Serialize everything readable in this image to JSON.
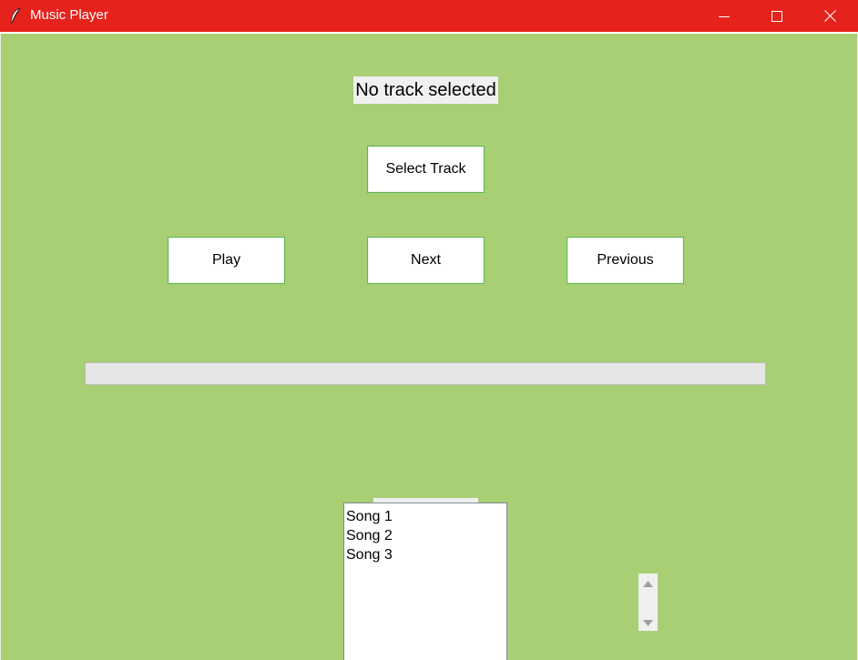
{
  "window": {
    "title": "Music Player"
  },
  "status": {
    "text": "No track selected"
  },
  "buttons": {
    "select_track": "Select Track",
    "play": "Play",
    "next": "Next",
    "previous": "Previous"
  },
  "progress": {
    "value": 0
  },
  "playlist": {
    "items": [
      "Song 1",
      "Song 2",
      "Song 3"
    ]
  },
  "colors": {
    "titlebar": "#e5221b",
    "background": "#a8cf74",
    "button_border": "#61b45a"
  },
  "icons": {
    "app": "feather-icon",
    "minimize": "minimize-icon",
    "maximize": "maximize-icon",
    "close": "close-icon",
    "scroll_up": "triangle-up-icon",
    "scroll_down": "triangle-down-icon"
  }
}
